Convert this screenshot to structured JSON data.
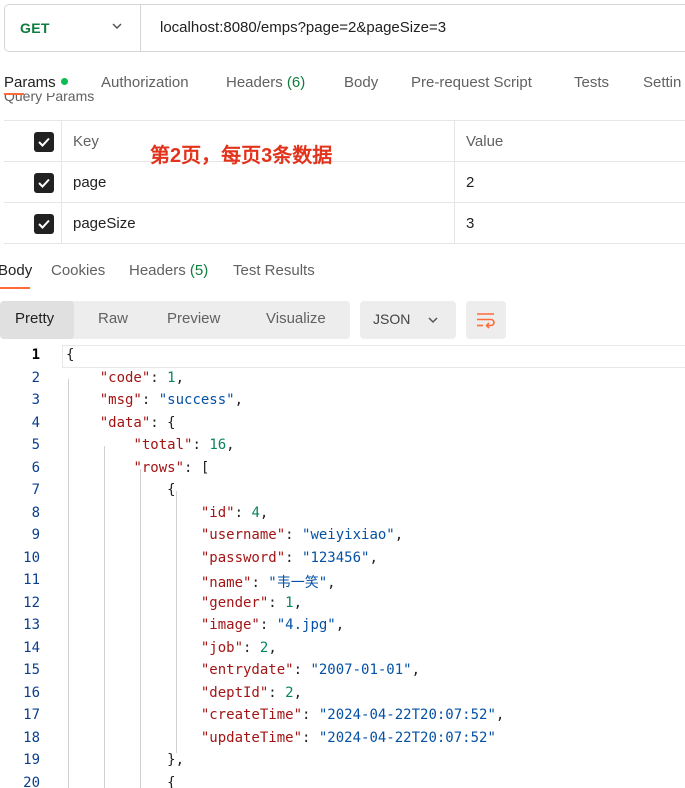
{
  "request": {
    "method": "GET",
    "url": "localhost:8080/emps?page=2&pageSize=3"
  },
  "request_tabs": [
    {
      "label": "Params",
      "active": true
    },
    {
      "label": "Authorization"
    },
    {
      "label": "Headers",
      "count": "(6)"
    },
    {
      "label": "Body"
    },
    {
      "label": "Pre-request Script"
    },
    {
      "label": "Tests"
    },
    {
      "label": "Settin"
    }
  ],
  "query_params_label": "Query Params",
  "params": {
    "header": {
      "key": "Key",
      "value": "Value"
    },
    "rows": [
      {
        "key": "page",
        "value": "2",
        "checked": true
      },
      {
        "key": "pageSize",
        "value": "3",
        "checked": true
      }
    ]
  },
  "annotation": "第2页，每页3条数据",
  "response_tabs": [
    {
      "label": "Body",
      "active": true
    },
    {
      "label": "Cookies"
    },
    {
      "label": "Headers",
      "count": "(5)"
    },
    {
      "label": "Test Results"
    }
  ],
  "format": {
    "modes": [
      "Pretty",
      "Raw",
      "Preview",
      "Visualize"
    ],
    "active": "Pretty",
    "language": "JSON"
  },
  "code_lines": [
    "{",
    "    \"code\": 1,",
    "    \"msg\": \"success\",",
    "    \"data\": {",
    "        \"total\": 16,",
    "        \"rows\": [",
    "            {",
    "                \"id\": 4,",
    "                \"username\": \"weiyixiao\",",
    "                \"password\": \"123456\",",
    "                \"name\": \"韦一笑\",",
    "                \"gender\": 1,",
    "                \"image\": \"4.jpg\",",
    "                \"job\": 2,",
    "                \"entrydate\": \"2007-01-01\",",
    "                \"deptId\": 2,",
    "                \"createTime\": \"2024-04-22T20:07:52\",",
    "                \"updateTime\": \"2024-04-22T20:07:52\"",
    "            },",
    "            {"
  ],
  "colors": {
    "accent": "#ff6c37",
    "method": "#0f7c3e",
    "annotation": "#e2341d",
    "json_key": "#a31515",
    "json_string": "#0451a5",
    "json_number": "#098658"
  }
}
